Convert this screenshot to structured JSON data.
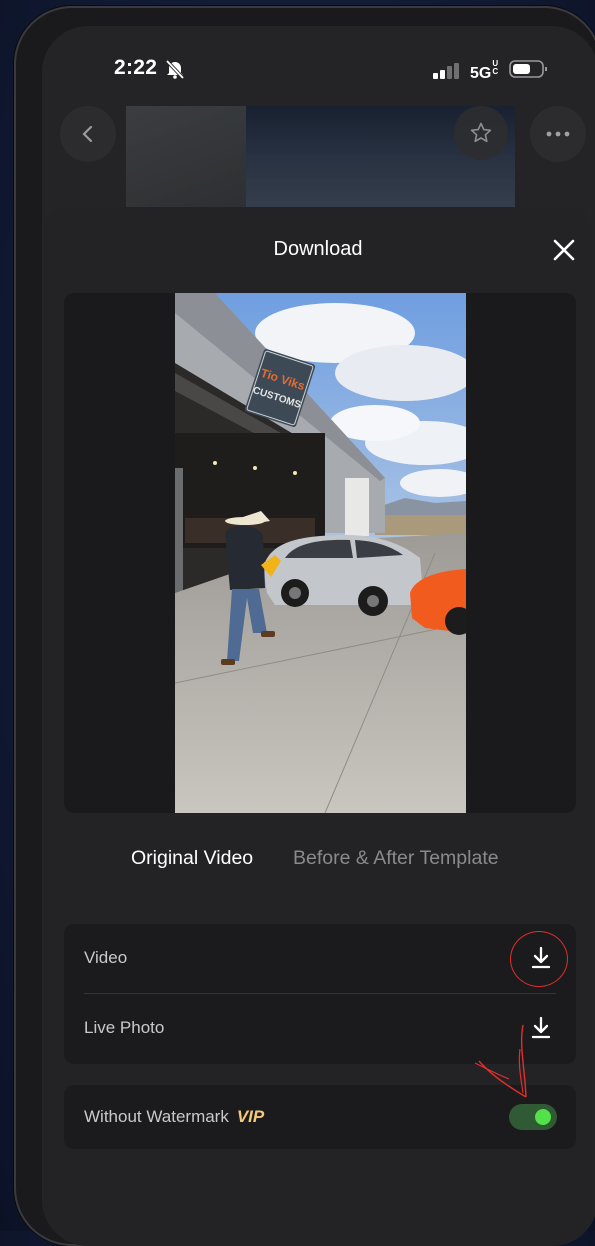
{
  "status_bar": {
    "time": "2:22",
    "network": "5G",
    "network_suffix": "UC"
  },
  "sheet": {
    "title": "Download"
  },
  "tabs": [
    {
      "label": "Original Video",
      "active": true
    },
    {
      "label": "Before & After Template",
      "active": false
    }
  ],
  "preview_sign": {
    "line1": "Tio Viks",
    "line2": "CUSTOMS"
  },
  "downloads": [
    {
      "label": "Video",
      "icon": "download-icon"
    },
    {
      "label": "Live Photo",
      "icon": "download-icon"
    }
  ],
  "watermark": {
    "label": "Without Watermark",
    "badge": "VIP",
    "enabled": true
  },
  "colors": {
    "toggle_on": "#52e04b",
    "vip": "#f3c97a",
    "annotation": "#e0302a"
  }
}
